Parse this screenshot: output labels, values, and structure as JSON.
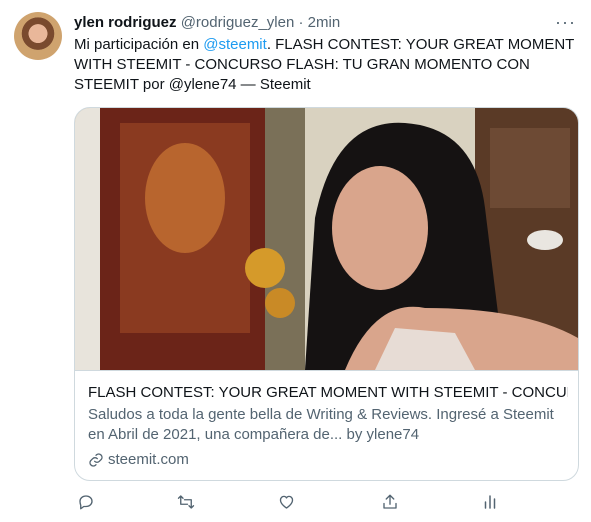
{
  "tweet": {
    "name": "ylen rodriguez",
    "handle": "@rodriguez_ylen",
    "separator": "·",
    "time": "2min",
    "more": "···",
    "text_before": "Mi participación en ",
    "mention": "@steemit",
    "text_after": ". FLASH CONTEST: YOUR GREAT MOMENT WITH STEEMIT - CONCURSO FLASH: TU GRAN MOMENTO CON STEEMIT por @ylene74 — Steemit"
  },
  "card": {
    "title": "FLASH CONTEST: YOUR GREAT MOMENT WITH STEEMIT - CONCUR...",
    "description": "Saludos a toda la gente bella de Writing & Reviews. Ingresé a Steemit en Abril de 2021, una compañera de... by ylene74",
    "domain": "steemit.com"
  },
  "actions": [
    "reply-icon",
    "retweet-icon",
    "like-icon",
    "share-icon",
    "analytics-icon"
  ],
  "colors": {
    "accent": "#1d9bf0",
    "secondary_text": "#536471",
    "border": "#cfd9de"
  }
}
